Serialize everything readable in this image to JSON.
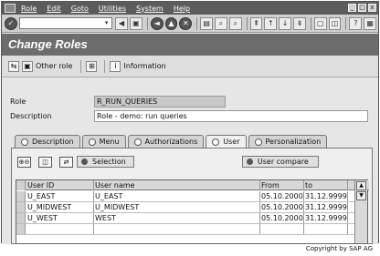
{
  "menubar": {
    "items": [
      "Role",
      "Edit",
      "Goto",
      "Utilities",
      "System",
      "Help"
    ],
    "window_controls": [
      "_",
      "□",
      "x"
    ]
  },
  "system_toolbar": {
    "command_field_value": "",
    "command_dropdown_glyph": "▾",
    "icons": [
      {
        "name": "enter-icon",
        "glyph": "✓"
      },
      {
        "name": "back-arrow-icon",
        "glyph": "◀"
      },
      {
        "name": "save-icon",
        "glyph": "▣"
      },
      {
        "name": "back-icon",
        "glyph": "◄"
      },
      {
        "name": "exit-icon",
        "glyph": "▲"
      },
      {
        "name": "cancel-icon",
        "glyph": "✕"
      },
      {
        "name": "print-icon",
        "glyph": "▤"
      },
      {
        "name": "find-icon",
        "glyph": "⌕"
      },
      {
        "name": "find-next-icon",
        "glyph": "⌕"
      },
      {
        "name": "first-page-icon",
        "glyph": "⇞"
      },
      {
        "name": "previous-page-icon",
        "glyph": "↑"
      },
      {
        "name": "next-page-icon",
        "glyph": "↓"
      },
      {
        "name": "last-page-icon",
        "glyph": "⇟"
      },
      {
        "name": "new-session-icon",
        "glyph": "▢"
      },
      {
        "name": "shortcut-icon",
        "glyph": "◫"
      },
      {
        "name": "help-icon",
        "glyph": "?"
      },
      {
        "name": "layout-icon",
        "glyph": "▦"
      }
    ]
  },
  "title": "Change Roles",
  "app_toolbar": {
    "other_role_label": "Other role",
    "information_label": "Information",
    "icons": {
      "display_change": "⇆",
      "other_role": "▣",
      "hierarchy": "⊞",
      "information": "i"
    }
  },
  "form": {
    "role_label": "Role",
    "role_value": "R_RUN_QUERIES",
    "description_label": "Description",
    "description_value": "Role - demo: run queries"
  },
  "tabs": [
    {
      "label": "Description",
      "icon": "description-tab-icon",
      "active": false
    },
    {
      "label": "Menu",
      "icon": "menu-tab-icon",
      "active": false
    },
    {
      "label": "Authorizations",
      "icon": "authorizations-tab-icon",
      "active": false
    },
    {
      "label": "User",
      "icon": "user-tab-icon",
      "active": true
    },
    {
      "label": "Personalization",
      "icon": "personalization-tab-icon",
      "active": false
    }
  ],
  "user_tab": {
    "square_buttons": [
      "⊕⊖",
      "◫",
      "⇄"
    ],
    "selection_label": "Selection",
    "user_compare_label": "User compare",
    "table": {
      "columns": [
        "User ID",
        "User name",
        "From",
        "to"
      ],
      "rows": [
        [
          "U_EAST",
          "U_EAST",
          "05.10.2000",
          "31.12.9999"
        ],
        [
          "U_MIDWEST",
          "U_MIDWEST",
          "05.10.2000",
          "31.12.9999"
        ],
        [
          "U_WEST",
          "WEST",
          "05.10.2000",
          "31.12.9999"
        ]
      ],
      "scroll_up_glyph": "▲",
      "scroll_down_glyph": "▼"
    }
  },
  "copyright": "Copyright by SAP AG"
}
